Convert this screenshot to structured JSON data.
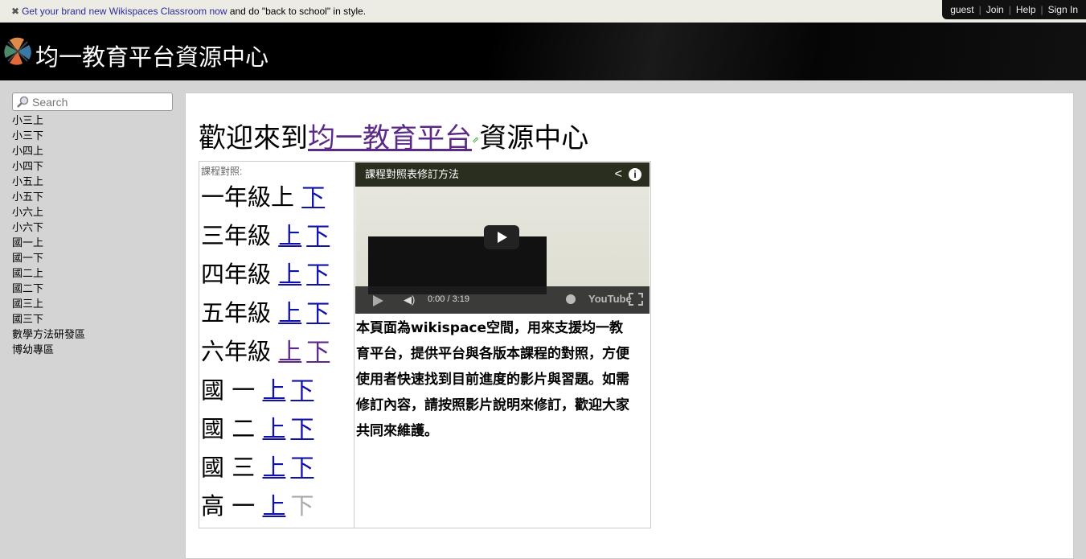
{
  "notice": {
    "link": "Get your brand new Wikispaces Classroom now",
    "text": " and do \"back to school\" in style."
  },
  "userbar": {
    "items": [
      "guest",
      "Join",
      "Help",
      "Sign In"
    ]
  },
  "header": {
    "site_title": "均一教育平台資源中心"
  },
  "sidebar": {
    "search_placeholder": "Search",
    "items": [
      "小三上",
      "小三下",
      "小四上",
      "小四下",
      "小五上",
      "小五下",
      "小六上",
      "小六下",
      "國一上",
      "國一下",
      "國二上",
      "國二下",
      "國三上",
      "國三下",
      "數學方法研發區",
      "博幼專區"
    ]
  },
  "main": {
    "title_prefix": "歡迎來到",
    "title_link": "均一教育平台",
    "title_suffix": "資源中心",
    "table_caption": "課程對照:",
    "grades": [
      {
        "label": "一年級上 ",
        "links": [
          {
            "text": "下",
            "state": "link"
          }
        ]
      },
      {
        "label": "三年級 ",
        "links": [
          {
            "text": "上",
            "state": "link"
          },
          {
            "text": "下",
            "state": "link"
          }
        ]
      },
      {
        "label": "四年級 ",
        "links": [
          {
            "text": "上",
            "state": "link"
          },
          {
            "text": "下",
            "state": "link"
          }
        ]
      },
      {
        "label": "五年級 ",
        "links": [
          {
            "text": "上",
            "state": "link"
          },
          {
            "text": "下",
            "state": "link"
          }
        ]
      },
      {
        "label": "六年級 ",
        "links": [
          {
            "text": "上",
            "state": "visited"
          },
          {
            "text": "下",
            "state": "visited"
          }
        ]
      },
      {
        "label": "國 一 ",
        "links": [
          {
            "text": "上",
            "state": "link"
          },
          {
            "text": "下",
            "state": "link"
          }
        ]
      },
      {
        "label": "國 二 ",
        "links": [
          {
            "text": "上",
            "state": "link"
          },
          {
            "text": "下",
            "state": "link"
          }
        ]
      },
      {
        "label": "國 三 ",
        "links": [
          {
            "text": "上",
            "state": "link"
          },
          {
            "text": "下",
            "state": "link"
          }
        ]
      },
      {
        "label": "高 一 ",
        "links": [
          {
            "text": "上",
            "state": "link"
          },
          {
            "text": "下",
            "state": "disabled"
          }
        ]
      }
    ],
    "video": {
      "title": "課程對照表修訂方法",
      "time": "0:00 / 3:19",
      "brand": "YouTube",
      "progress": 0
    },
    "description": "本頁面為wikispace空間，用來支援均一教育平台，提供平台與各版本課程的對照，方便使用者快速找到目前進度的影片與習題。如需修訂內容，請按照影片說明來修訂，歡迎大家共同來維護。"
  },
  "colors": {
    "link": "#1111aa",
    "visited": "#5a2a86",
    "disabled": "#aaaaaa",
    "header_bg": "#000000"
  }
}
